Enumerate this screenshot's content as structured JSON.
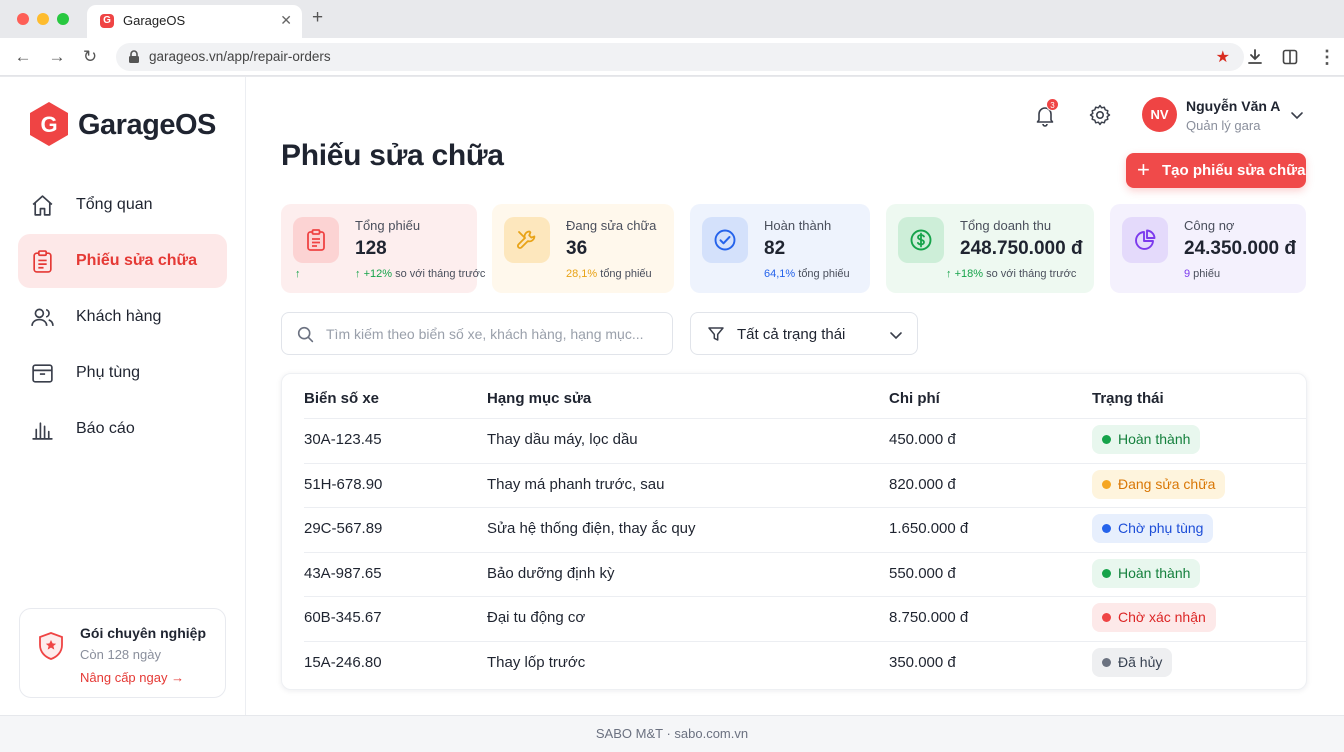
{
  "browser": {
    "tab_title": "GarageOS",
    "tab_favicon": "G",
    "url": "garageos.vn/app/repair-orders"
  },
  "brand": {
    "name": "GarageOS",
    "logo_letter": "G",
    "accent": "#ef4444"
  },
  "sidebar": {
    "items": [
      {
        "label": "Tổng quan",
        "icon": "home-icon",
        "active": false
      },
      {
        "label": "Phiếu sửa chữa",
        "icon": "clipboard-icon",
        "active": true
      },
      {
        "label": "Khách hàng",
        "icon": "users-icon",
        "active": false
      },
      {
        "label": "Phụ tùng",
        "icon": "box-icon",
        "active": false
      },
      {
        "label": "Báo cáo",
        "icon": "bar-chart-icon",
        "active": false
      }
    ],
    "plan": {
      "title": "Gói chuyên nghiệp",
      "subtitle": "Còn 128 ngày",
      "link": "Nâng cấp ngay →"
    }
  },
  "header": {
    "notifications_count": "3",
    "user": {
      "initials": "NV",
      "name": "Nguyễn Văn A",
      "role": "Quản lý gara"
    }
  },
  "page": {
    "title": "Phiếu sửa chữa",
    "create_button": "Tạo phiếu sửa chữa"
  },
  "stats": [
    {
      "label": "Tổng phiếu",
      "value": "128",
      "note_highlight": "+12%",
      "note_rest": " so với tháng trước",
      "icon": "clipboard-icon",
      "color": "#ef4444",
      "bg": "#fdeeee",
      "icon_bg": "#fcd3d3"
    },
    {
      "label": "Đang sửa chữa",
      "value": "36",
      "note_highlight": "28,1%",
      "note_rest": " tổng phiếu",
      "icon": "wrench-icon",
      "color": "#e8a317",
      "bg": "#fff8ec",
      "icon_bg": "#fde7bd"
    },
    {
      "label": "Hoàn thành",
      "value": "82",
      "note_highlight": "64,1%",
      "note_rest": " tổng phiếu",
      "icon": "check-circle-icon",
      "color": "#2563eb",
      "bg": "#eef3fd",
      "icon_bg": "#d4e1fb"
    },
    {
      "label": "Tổng doanh thu",
      "value": "248.750.000 đ",
      "note_highlight": "+18%",
      "note_rest": " so với tháng trước",
      "icon": "dollar-circle-icon",
      "color": "#16a34a",
      "bg": "#eef9f1",
      "icon_bg": "#cdeed8"
    },
    {
      "label": "Công nợ",
      "value": "24.350.000 đ",
      "note_highlight": "9",
      "note_rest": " phiếu",
      "icon": "pie-chart-icon",
      "color": "#7c3aed",
      "bg": "#f4f1fd",
      "icon_bg": "#e4dafb"
    }
  ],
  "search": {
    "placeholder": "Tìm kiếm theo biển số xe, khách hàng, hạng mục..."
  },
  "filter": {
    "label": "Tất cả trạng thái"
  },
  "table": {
    "columns": [
      "Biển số xe",
      "Hạng mục sửa",
      "Chi phí",
      "Trạng thái"
    ],
    "rows": [
      {
        "plate": "30A-123.45",
        "service": "Thay dầu máy, lọc dầu",
        "cost": "450.000 đ",
        "status": "Hoàn thành",
        "status_kind": "done"
      },
      {
        "plate": "51H-678.90",
        "service": "Thay má phanh trước, sau",
        "cost": "820.000 đ",
        "status": "Đang sửa chữa",
        "status_kind": "progress"
      },
      {
        "plate": "29C-567.89",
        "service": "Sửa hệ thống điện, thay ắc quy",
        "cost": "1.650.000 đ",
        "status": "Chờ phụ tùng",
        "status_kind": "parts"
      },
      {
        "plate": "43A-987.65",
        "service": "Bảo dưỡng định kỳ",
        "cost": "550.000 đ",
        "status": "Hoàn thành",
        "status_kind": "done"
      },
      {
        "plate": "60B-345.67",
        "service": "Đại tu động cơ",
        "cost": "8.750.000 đ",
        "status": "Chờ xác nhận",
        "status_kind": "confirm"
      },
      {
        "plate": "15A-246.80",
        "service": "Thay lốp trước",
        "cost": "350.000 đ",
        "status": "Đã hủy",
        "status_kind": "cancelled"
      }
    ]
  },
  "status_colors": {
    "done": {
      "dot": "#16a34a",
      "text": "#15803d",
      "bg": "#e8f7ee"
    },
    "progress": {
      "dot": "#f5a623",
      "text": "#d97706",
      "bg": "#fef4dd"
    },
    "parts": {
      "dot": "#2563eb",
      "text": "#1d4ed8",
      "bg": "#e7effd"
    },
    "confirm": {
      "dot": "#ef4444",
      "text": "#dc2626",
      "bg": "#fde9e9"
    },
    "cancelled": {
      "dot": "#6b7280",
      "text": "#374151",
      "bg": "#eeeff1"
    }
  },
  "footer": {
    "text": "SABO M&T · sabo.com.vn"
  }
}
